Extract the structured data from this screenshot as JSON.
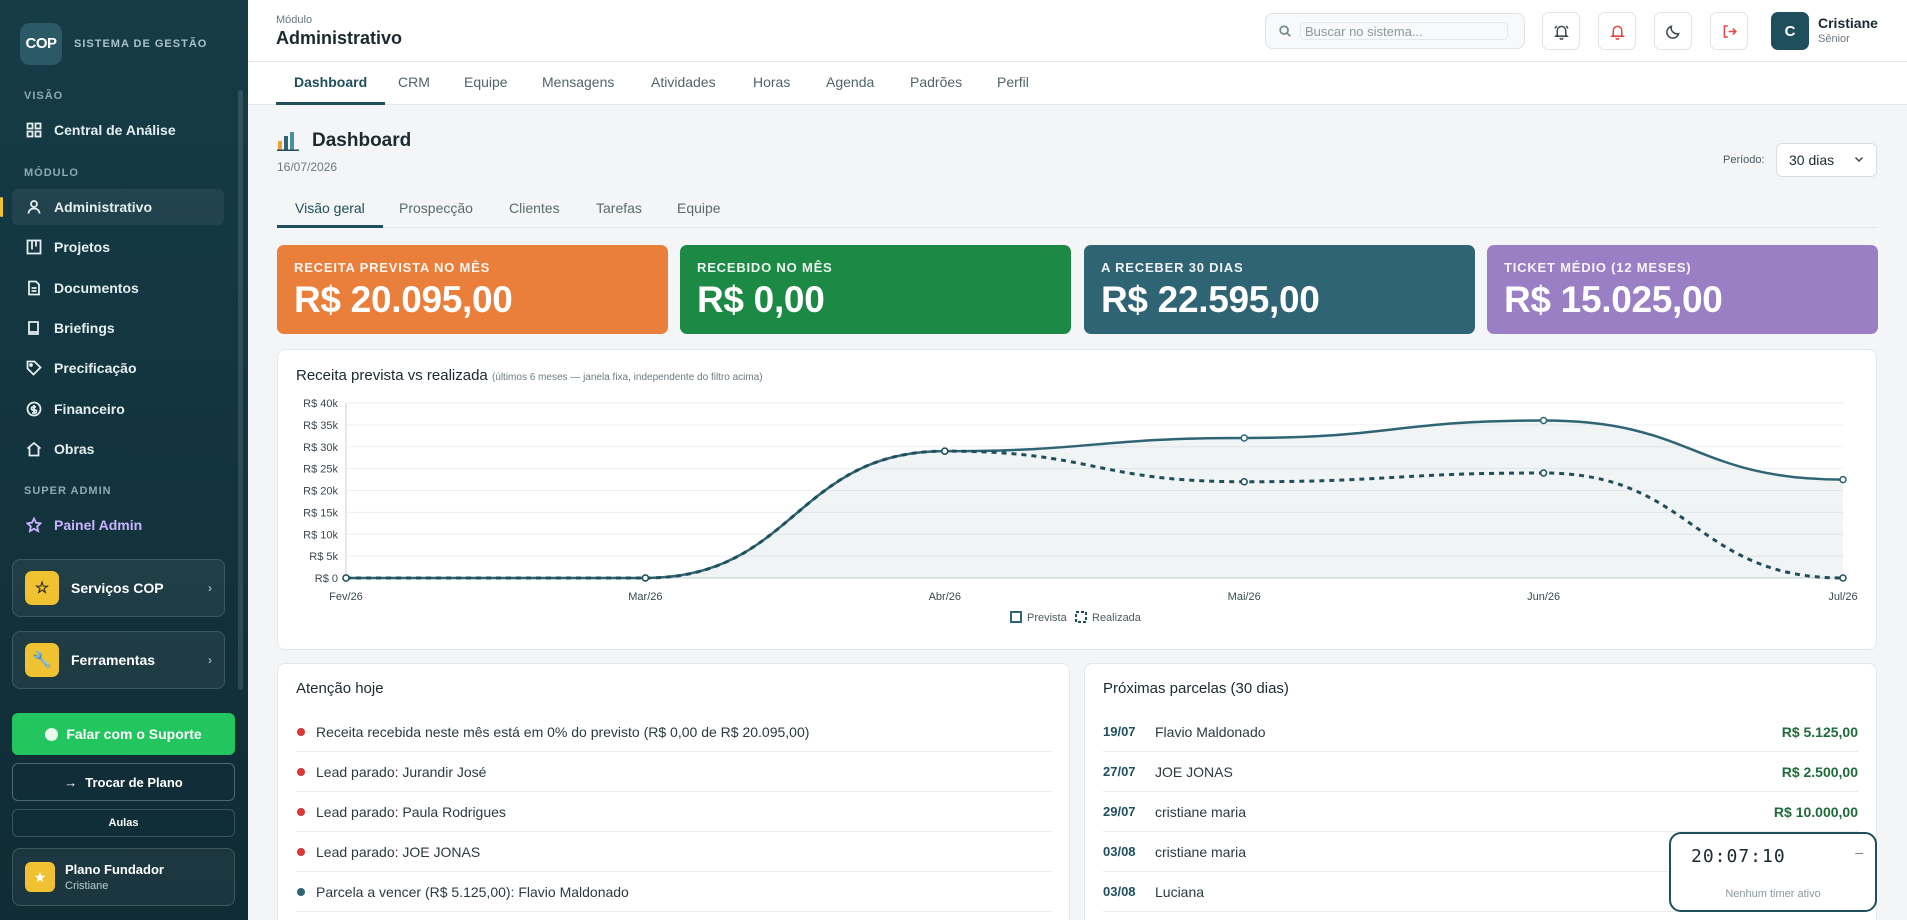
{
  "brand": {
    "logo": "COP",
    "name": "SISTEMA DE GESTÃO"
  },
  "sidebar": {
    "sections": {
      "visao": "VISÃO",
      "modulo": "MÓDULO",
      "super_admin": "SUPER ADMIN"
    },
    "items": [
      {
        "label": "Central de Análise",
        "icon": "grid-icon"
      },
      {
        "label": "Administrativo",
        "icon": "user-icon",
        "active": true
      },
      {
        "label": "Projetos",
        "icon": "kanban-icon"
      },
      {
        "label": "Documentos",
        "icon": "document-icon"
      },
      {
        "label": "Briefings",
        "icon": "book-icon"
      },
      {
        "label": "Precificação",
        "icon": "tag-icon"
      },
      {
        "label": "Financeiro",
        "icon": "coin-icon"
      },
      {
        "label": "Obras",
        "icon": "home-icon"
      }
    ],
    "admin": {
      "label": "Painel Admin",
      "icon": "star-icon"
    },
    "cards": [
      {
        "label": "Serviços COP",
        "icon": "star-icon"
      },
      {
        "label": "Ferramentas",
        "icon": "wrench-icon"
      }
    ],
    "support_label": "Falar com o Suporte",
    "change_plan_label": "Trocar de Plano",
    "aulas_label": "Aulas",
    "plan": {
      "title": "Plano Fundador",
      "user": "Cristiane"
    }
  },
  "header": {
    "module_label": "Módulo",
    "module_title": "Administrativo",
    "search_placeholder": "Buscar no sistema...",
    "user": {
      "initial": "C",
      "name": "Cristiane",
      "role": "Sênior"
    }
  },
  "nav_tabs": [
    "Dashboard",
    "CRM",
    "Equipe",
    "Mensagens",
    "Atividades",
    "Horas",
    "Agenda",
    "Padrões",
    "Perfil"
  ],
  "page": {
    "title": "Dashboard",
    "date": "16/07/2026",
    "period_label": "Período:",
    "period_value": "30 dias",
    "subtabs": [
      "Visão geral",
      "Prospecção",
      "Clientes",
      "Tarefas",
      "Equipe"
    ]
  },
  "kpis": [
    {
      "label": "RECEITA PREVISTA NO MÊS",
      "value": "R$ 20.095,00",
      "color": "#e97f3b"
    },
    {
      "label": "RECEBIDO NO MÊS",
      "value": "R$ 0,00",
      "color": "#1c8a44"
    },
    {
      "label": "A RECEBER 30 DIAS",
      "value": "R$ 22.595,00",
      "color": "#2f6475"
    },
    {
      "label": "TICKET MÉDIO (12 MESES)",
      "value": "R$ 15.025,00",
      "color": "#9b7fc4"
    }
  ],
  "chart_title": "Receita prevista vs realizada",
  "chart_subtitle": "(últimos 6 meses — janela fixa, independente do filtro acima)",
  "chart_data": {
    "type": "line",
    "x": [
      "Fev/26",
      "Mar/26",
      "Abr/26",
      "Mai/26",
      "Jun/26",
      "Jul/26"
    ],
    "y_ticks": [
      "R$ 0",
      "R$ 5k",
      "R$ 10k",
      "R$ 15k",
      "R$ 20k",
      "R$ 25k",
      "R$ 30k",
      "R$ 35k",
      "R$ 40k"
    ],
    "ylim": [
      0,
      40000
    ],
    "series": [
      {
        "name": "Prevista",
        "values": [
          0,
          0,
          29000,
          32000,
          36000,
          22500
        ],
        "color": "#2f6475",
        "style": "solid"
      },
      {
        "name": "Realizada",
        "values": [
          0,
          0,
          29000,
          22000,
          24000,
          0
        ],
        "color": "#1f4f5c",
        "style": "dashed"
      }
    ],
    "legend": "bottom-center",
    "grid": true
  },
  "attention": {
    "title": "Atenção hoje",
    "items": [
      {
        "text": "Receita recebida neste mês está em 0% do previsto (R$ 0,00 de R$ 20.095,00)",
        "color": "#d93636"
      },
      {
        "text": "Lead parado: Jurandir José",
        "color": "#d93636"
      },
      {
        "text": "Lead parado: Paula Rodrigues",
        "color": "#d93636"
      },
      {
        "text": "Lead parado: JOE JONAS",
        "color": "#d93636"
      },
      {
        "text": "Parcela a vencer (R$ 5.125,00): Flavio Maldonado",
        "color": "#2f6475"
      }
    ]
  },
  "installments": {
    "title": "Próximas parcelas (30 dias)",
    "items": [
      {
        "date": "19/07",
        "name": "Flavio Maldonado",
        "value": "R$ 5.125,00"
      },
      {
        "date": "27/07",
        "name": "JOE JONAS",
        "value": "R$ 2.500,00"
      },
      {
        "date": "29/07",
        "name": "cristiane maria",
        "value": "R$ 10.000,00"
      },
      {
        "date": "03/08",
        "name": "cristiane maria",
        "value": ""
      },
      {
        "date": "03/08",
        "name": "Luciana",
        "value": ""
      }
    ]
  },
  "timer": {
    "time": "20:07:10",
    "status": "Nenhum timer ativo",
    "minimize": "–"
  }
}
